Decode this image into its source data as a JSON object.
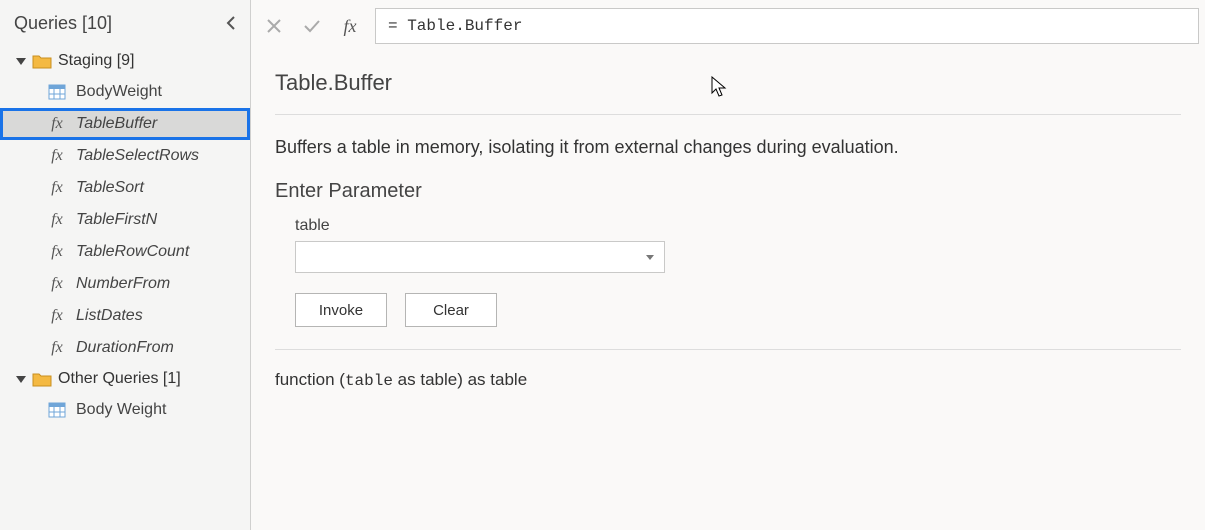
{
  "sidebar": {
    "title": "Queries [10]",
    "groups": [
      {
        "label": "Staging [9]",
        "items": [
          {
            "kind": "table",
            "label": "BodyWeight"
          },
          {
            "kind": "fx",
            "label": "TableBuffer",
            "selected": true
          },
          {
            "kind": "fx",
            "label": "TableSelectRows"
          },
          {
            "kind": "fx",
            "label": "TableSort"
          },
          {
            "kind": "fx",
            "label": "TableFirstN"
          },
          {
            "kind": "fx",
            "label": "TableRowCount"
          },
          {
            "kind": "fx",
            "label": "NumberFrom"
          },
          {
            "kind": "fx",
            "label": "ListDates"
          },
          {
            "kind": "fx",
            "label": "DurationFrom"
          }
        ]
      },
      {
        "label": "Other Queries [1]",
        "items": [
          {
            "kind": "table",
            "label": "Body Weight"
          }
        ]
      }
    ]
  },
  "formula_bar": {
    "cancel": "✕",
    "commit": "✓",
    "fx": "fx",
    "value": "= Table.Buffer"
  },
  "detail": {
    "title": "Table.Buffer",
    "description": "Buffers a table in memory, isolating it from external changes during evaluation.",
    "param_heading": "Enter Parameter",
    "param_label": "table",
    "invoke": "Invoke",
    "clear": "Clear",
    "signature_prefix": "function (",
    "signature_arg": "table",
    "signature_mid": " as table) as table"
  }
}
